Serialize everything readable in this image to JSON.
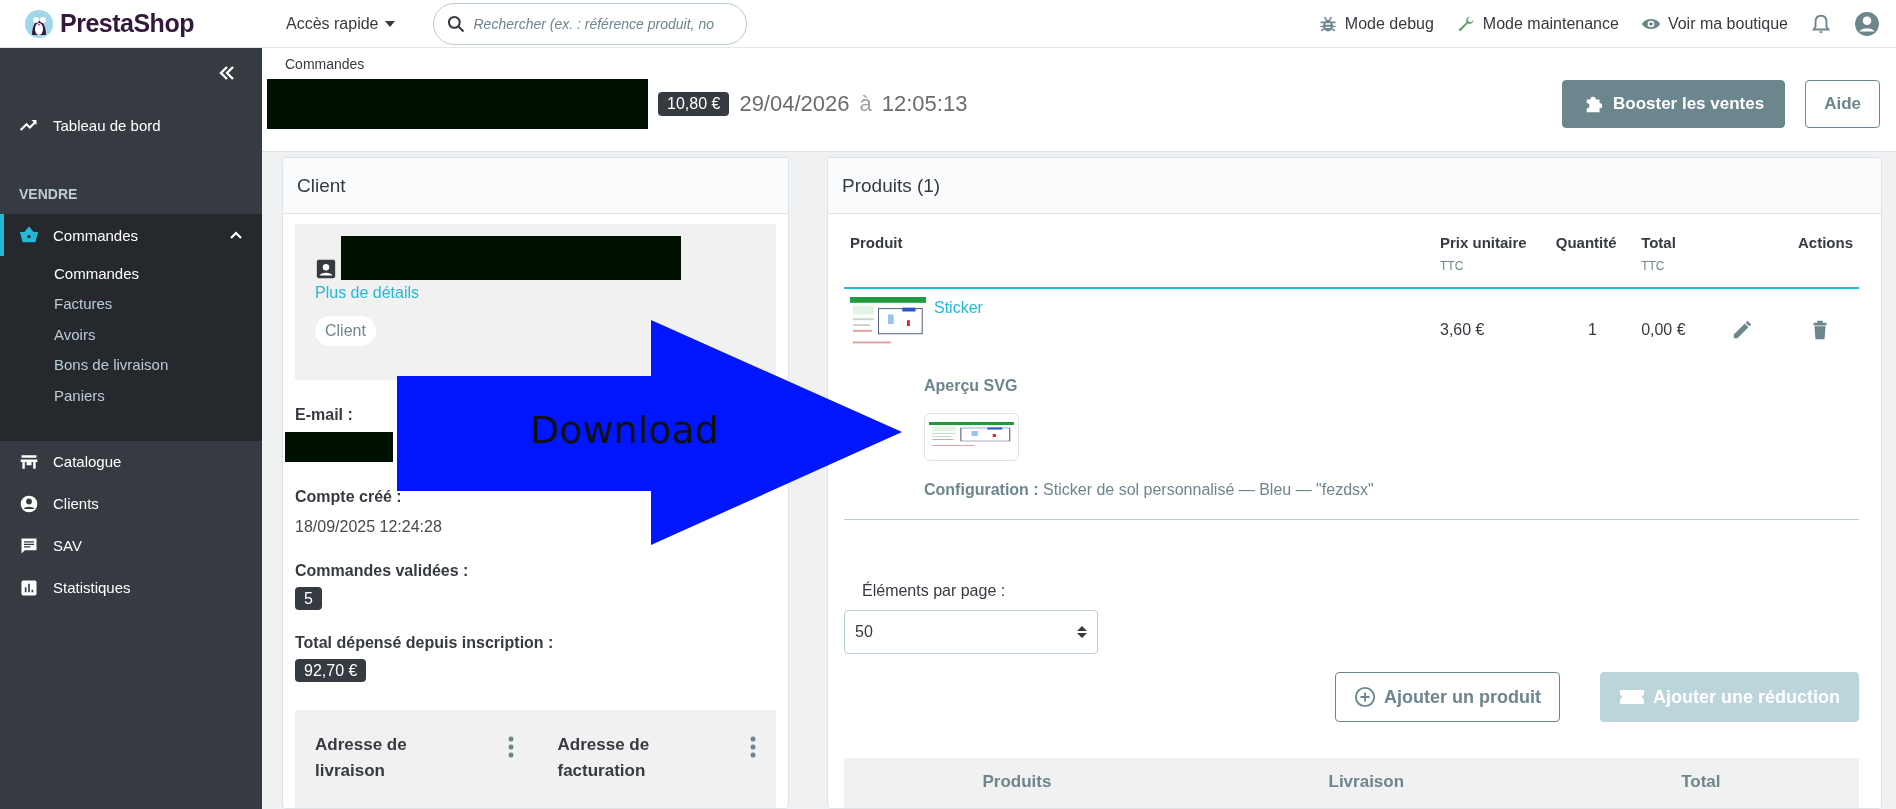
{
  "header": {
    "logo": "PrestaShop",
    "quick_access": "Accès rapide",
    "search": {
      "placeholder": "Rechercher (ex. : référence produit, no"
    },
    "links": [
      {
        "kind": "debug",
        "label": "Mode debug"
      },
      {
        "kind": "maintenance",
        "label": "Mode maintenance"
      },
      {
        "kind": "view",
        "label": "Voir ma boutique"
      }
    ]
  },
  "sidebar": {
    "sections": [
      {
        "items": [
          {
            "kind": "dashboard",
            "label": "Tableau de bord",
            "selected": false
          }
        ]
      },
      {
        "title": "VENDRE",
        "items": [
          {
            "kind": "orders",
            "label": "Commandes",
            "selected": true,
            "expanded": true,
            "children": [
              {
                "label": "Commandes",
                "selected": true
              },
              {
                "label": "Factures",
                "selected": false
              },
              {
                "label": "Avoirs",
                "selected": false
              },
              {
                "label": "Bons de livraison",
                "selected": false
              },
              {
                "label": "Paniers",
                "selected": false
              }
            ]
          },
          {
            "kind": "catalog",
            "label": "Catalogue",
            "selected": false
          },
          {
            "kind": "customers",
            "label": "Clients",
            "selected": false
          },
          {
            "kind": "service",
            "label": "SAV",
            "selected": false
          },
          {
            "kind": "stats",
            "label": "Statistiques",
            "selected": false
          }
        ]
      }
    ]
  },
  "breadcrumb": "Commandes",
  "order": {
    "total": "10,80 €",
    "date": "29/04/2026",
    "at": "à",
    "time": "12:05:13"
  },
  "toolbar": [
    "Booster les ventes",
    "Aide"
  ],
  "client": {
    "title": "Client",
    "details_link": "Plus de détails",
    "group": "Client",
    "fields": [
      {
        "label": "E-mail :",
        "kind": "redacted"
      },
      {
        "label": "Compte créé :",
        "kind": "text",
        "value": "18/09/2025 12:24:28"
      },
      {
        "label": "Commandes validées :",
        "kind": "badge",
        "value": "5"
      },
      {
        "label": "Total dépensé depuis inscription :",
        "kind": "badge",
        "value": "92,70 €"
      }
    ],
    "addresses": [
      "Adresse de livraison",
      "Adresse de facturation"
    ]
  },
  "products": {
    "title": "Produits (1)",
    "columns": [
      {
        "label": "Produit"
      },
      {
        "label": "Prix unitaire",
        "sublabel": "TTC"
      },
      {
        "label": "Quantité"
      },
      {
        "label": "Total",
        "sublabel": "TTC"
      },
      {
        "label": "Actions"
      }
    ],
    "rows": [
      {
        "name": "Sticker",
        "unit_price": "3,60 €",
        "quantity": "1",
        "total": "0,00 €",
        "preview_label": "Aperçu SVG",
        "configuration": "**Configuration :** Sticker de sol personnalisé — Bleu — \"fezdsx\""
      }
    ],
    "per_page_label": "Éléments par page :",
    "per_page": "50",
    "buttons": [
      {
        "label": "Ajouter un produit",
        "disabled": false
      },
      {
        "label": "Ajouter une réduction",
        "disabled": true
      }
    ],
    "summary_columns": [
      "Produits",
      "Livraison",
      "Total"
    ]
  },
  "annotation": {
    "label": "Download"
  }
}
